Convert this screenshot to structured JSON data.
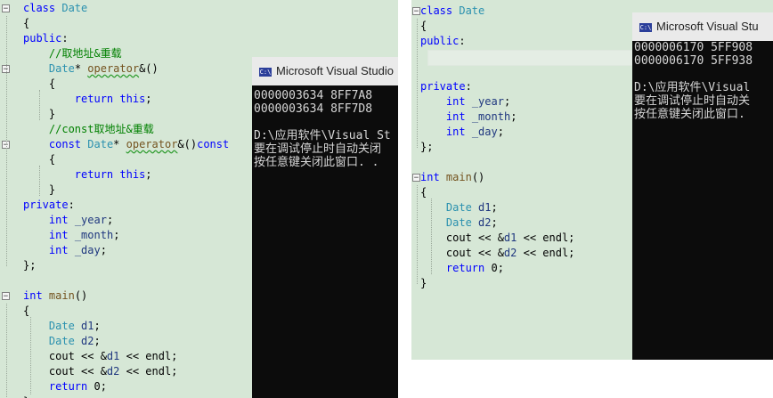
{
  "left": {
    "lines": [
      [
        {
          "t": "class",
          "c": "kw"
        },
        {
          "t": " "
        },
        {
          "t": "Date",
          "c": "ty"
        }
      ],
      [
        {
          "t": "{"
        }
      ],
      [
        {
          "t": "public",
          "c": "kw"
        },
        {
          "t": ":"
        }
      ],
      [
        {
          "t": "    "
        },
        {
          "t": "//取地址&重载",
          "c": "cm"
        }
      ],
      [
        {
          "t": "    "
        },
        {
          "t": "Date",
          "c": "ty"
        },
        {
          "t": "* "
        },
        {
          "t": "operator",
          "c": "fn sq"
        },
        {
          "t": "&()"
        }
      ],
      [
        {
          "t": "    {"
        }
      ],
      [
        {
          "t": "        "
        },
        {
          "t": "return",
          "c": "kw"
        },
        {
          "t": " "
        },
        {
          "t": "this",
          "c": "kw"
        },
        {
          "t": ";"
        }
      ],
      [
        {
          "t": "    }"
        }
      ],
      [
        {
          "t": "    "
        },
        {
          "t": "//const取地址&重载",
          "c": "cm"
        }
      ],
      [
        {
          "t": "    "
        },
        {
          "t": "const",
          "c": "kw"
        },
        {
          "t": " "
        },
        {
          "t": "Date",
          "c": "ty"
        },
        {
          "t": "* "
        },
        {
          "t": "operator",
          "c": "fn sq"
        },
        {
          "t": "&()"
        },
        {
          "t": "const",
          "c": "kw"
        }
      ],
      [
        {
          "t": "    {"
        }
      ],
      [
        {
          "t": "        "
        },
        {
          "t": "return",
          "c": "kw"
        },
        {
          "t": " "
        },
        {
          "t": "this",
          "c": "kw"
        },
        {
          "t": ";"
        }
      ],
      [
        {
          "t": "    }"
        }
      ],
      [
        {
          "t": "private",
          "c": "kw"
        },
        {
          "t": ":"
        }
      ],
      [
        {
          "t": "    "
        },
        {
          "t": "int",
          "c": "kw"
        },
        {
          "t": " "
        },
        {
          "t": "_year",
          "c": "id"
        },
        {
          "t": ";"
        }
      ],
      [
        {
          "t": "    "
        },
        {
          "t": "int",
          "c": "kw"
        },
        {
          "t": " "
        },
        {
          "t": "_month",
          "c": "id"
        },
        {
          "t": ";"
        }
      ],
      [
        {
          "t": "    "
        },
        {
          "t": "int",
          "c": "kw"
        },
        {
          "t": " "
        },
        {
          "t": "_day",
          "c": "id"
        },
        {
          "t": ";"
        }
      ],
      [
        {
          "t": "};"
        }
      ],
      [
        {
          "t": ""
        }
      ],
      [
        {
          "t": "int",
          "c": "kw"
        },
        {
          "t": " "
        },
        {
          "t": "main",
          "c": "fn"
        },
        {
          "t": "()"
        }
      ],
      [
        {
          "t": "{"
        }
      ],
      [
        {
          "t": "    "
        },
        {
          "t": "Date",
          "c": "ty"
        },
        {
          "t": " "
        },
        {
          "t": "d1",
          "c": "id"
        },
        {
          "t": ";"
        }
      ],
      [
        {
          "t": "    "
        },
        {
          "t": "Date",
          "c": "ty"
        },
        {
          "t": " "
        },
        {
          "t": "d2",
          "c": "id"
        },
        {
          "t": ";"
        }
      ],
      [
        {
          "t": "    cout << &"
        },
        {
          "t": "d1",
          "c": "id"
        },
        {
          "t": " << endl;"
        }
      ],
      [
        {
          "t": "    cout << &"
        },
        {
          "t": "d2",
          "c": "id"
        },
        {
          "t": " << endl;"
        }
      ],
      [
        {
          "t": "    "
        },
        {
          "t": "return",
          "c": "kw"
        },
        {
          "t": " 0;"
        }
      ],
      [
        {
          "t": "}"
        }
      ]
    ],
    "console": {
      "title": "Microsoft Visual Studio",
      "icon": "C:\\",
      "output": "0000003634 8FF7A8\n0000003634 8FF7D8\n\nD:\\应用软件\\Visual St\n要在调试停止时自动关闭\n按任意键关闭此窗口. ."
    }
  },
  "right": {
    "lines": [
      [
        {
          "t": "class",
          "c": "kw"
        },
        {
          "t": " "
        },
        {
          "t": "Date",
          "c": "ty"
        }
      ],
      [
        {
          "t": "{"
        }
      ],
      [
        {
          "t": "public",
          "c": "kw"
        },
        {
          "t": ":"
        }
      ],
      [
        {
          "t": ""
        }
      ],
      [
        {
          "t": ""
        }
      ],
      [
        {
          "t": "private",
          "c": "kw"
        },
        {
          "t": ":"
        }
      ],
      [
        {
          "t": "    "
        },
        {
          "t": "int",
          "c": "kw"
        },
        {
          "t": " "
        },
        {
          "t": "_year",
          "c": "id"
        },
        {
          "t": ";"
        }
      ],
      [
        {
          "t": "    "
        },
        {
          "t": "int",
          "c": "kw"
        },
        {
          "t": " "
        },
        {
          "t": "_month",
          "c": "id"
        },
        {
          "t": ";"
        }
      ],
      [
        {
          "t": "    "
        },
        {
          "t": "int",
          "c": "kw"
        },
        {
          "t": " "
        },
        {
          "t": "_day",
          "c": "id"
        },
        {
          "t": ";"
        }
      ],
      [
        {
          "t": "};"
        }
      ],
      [
        {
          "t": ""
        }
      ],
      [
        {
          "t": "int",
          "c": "kw"
        },
        {
          "t": " "
        },
        {
          "t": "main",
          "c": "fn"
        },
        {
          "t": "()"
        }
      ],
      [
        {
          "t": "{"
        }
      ],
      [
        {
          "t": "    "
        },
        {
          "t": "Date",
          "c": "ty"
        },
        {
          "t": " "
        },
        {
          "t": "d1",
          "c": "id"
        },
        {
          "t": ";"
        }
      ],
      [
        {
          "t": "    "
        },
        {
          "t": "Date",
          "c": "ty"
        },
        {
          "t": " "
        },
        {
          "t": "d2",
          "c": "id"
        },
        {
          "t": ";"
        }
      ],
      [
        {
          "t": "    cout << &"
        },
        {
          "t": "d1",
          "c": "id"
        },
        {
          "t": " << endl;"
        }
      ],
      [
        {
          "t": "    cout << &"
        },
        {
          "t": "d2",
          "c": "id"
        },
        {
          "t": " << endl;"
        }
      ],
      [
        {
          "t": "    "
        },
        {
          "t": "return",
          "c": "kw"
        },
        {
          "t": " 0;"
        }
      ],
      [
        {
          "t": "}"
        }
      ]
    ],
    "console": {
      "title": "Microsoft Visual Stu",
      "icon": "C:\\",
      "output": "0000006170 5FF908\n0000006170 5FF938\n\nD:\\应用软件\\Visual\n要在调试停止时自动关\n按任意键关闭此窗口."
    }
  }
}
